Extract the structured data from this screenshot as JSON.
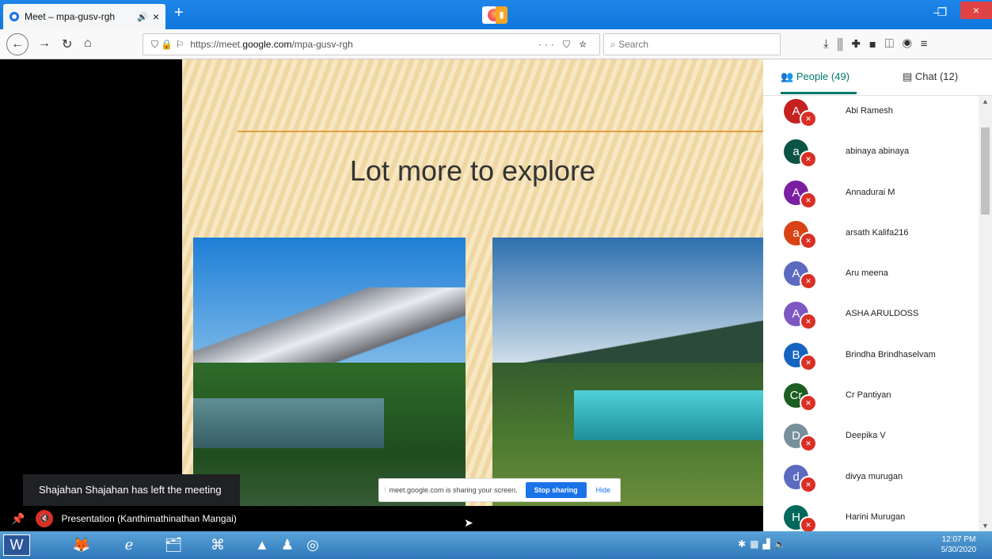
{
  "browser": {
    "tab_title": "Meet – mpa-gusv-rgh",
    "audio_icon": "🔊",
    "close_glyph": "×",
    "new_tab_glyph": "+",
    "win_min": "–",
    "win_max": "❐",
    "win_close": "×",
    "url_prefix": "https://meet.",
    "url_domain": "google.com",
    "url_suffix": "/mpa-gusv-rgh",
    "url_actions": "··· ⛉ ☆",
    "search_placeholder": "Search"
  },
  "stage": {
    "slide_title": "Lot more to explore",
    "share_message": "meet.google.com is sharing your screen.",
    "stop_sharing": "Stop sharing",
    "hide": "Hide",
    "toast": "Shajahan Shajahan has left the meeting",
    "presentation_label": "Presentation (Kanthimathinathan Mangai)"
  },
  "panel": {
    "people_tab": "People (49)",
    "chat_tab": "Chat (12)",
    "people": [
      {
        "initial": "A",
        "name": "Abi Ramesh",
        "color": "#c5221f"
      },
      {
        "initial": "a",
        "name": "abinaya abinaya",
        "color": "#0b5345"
      },
      {
        "initial": "A",
        "name": "Annadurai M",
        "color": "#7b1fa2"
      },
      {
        "initial": "a",
        "name": "arsath Kalifa216",
        "color": "#d84315"
      },
      {
        "initial": "A",
        "name": "Aru meena",
        "color": "#5c6bc0"
      },
      {
        "initial": "A",
        "name": "ASHA ARULDOSS",
        "color": "#7e57c2"
      },
      {
        "initial": "B",
        "name": "Brindha Brindhaselvam",
        "color": "#1565c0"
      },
      {
        "initial": "Cr",
        "name": "Cr Pantiyan",
        "color": "#1b5e20"
      },
      {
        "initial": "D",
        "name": "Deepika V",
        "color": "#78909c"
      },
      {
        "initial": "d",
        "name": "divya murugan",
        "color": "#5c6bc0"
      },
      {
        "initial": "H",
        "name": "Harini Murugan",
        "color": "#00695c"
      }
    ]
  },
  "taskbar": {
    "time": "12:07 PM",
    "date": "5/30/2020"
  }
}
